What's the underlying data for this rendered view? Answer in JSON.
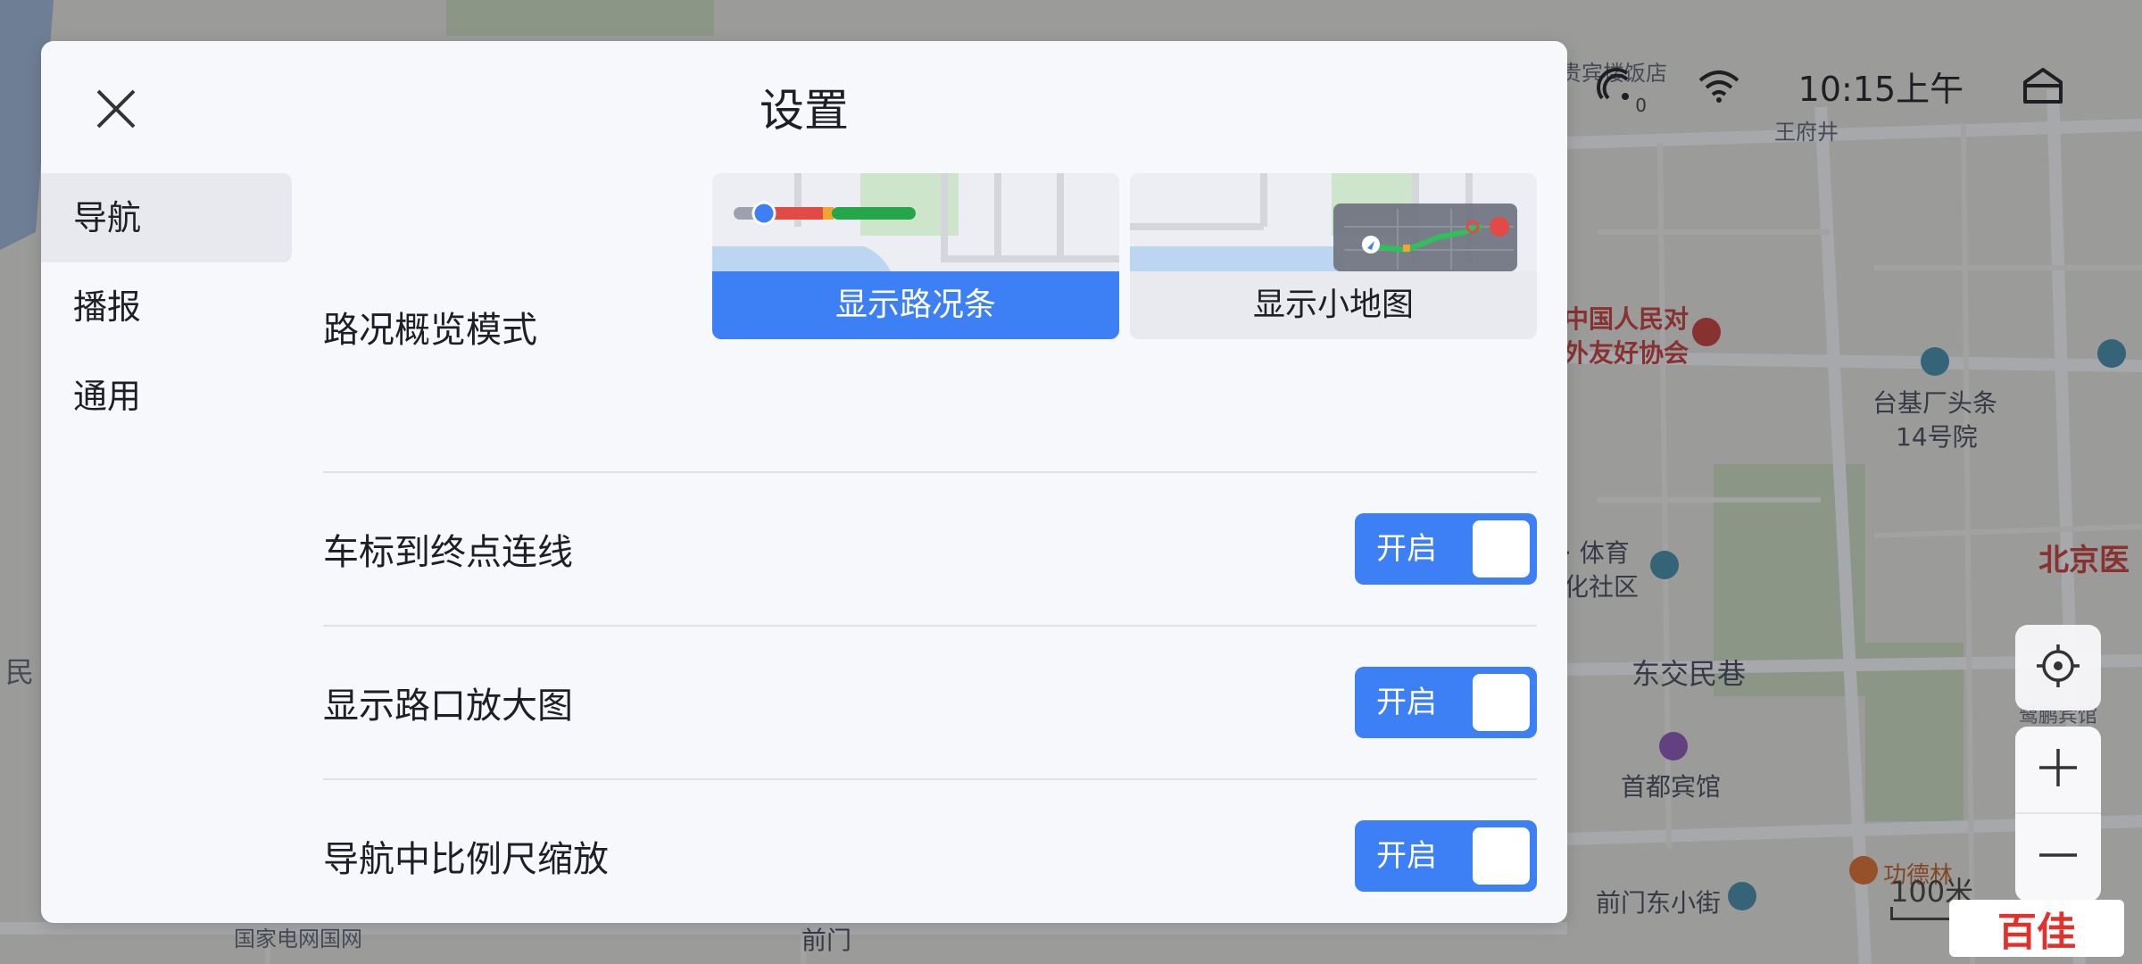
{
  "map": {
    "labels": {
      "hotel_top": "贵宾楼饭店",
      "wangfujing": "王府井",
      "friendship_assoc_1": "中国人民对",
      "friendship_assoc_2": "外友好协会",
      "taiji_1": "台基厂头条",
      "taiji_2": "14号院",
      "sports_1": "· 体育",
      "sports_2": "化社区",
      "dongjiaominxiang": "东交民巷",
      "beijing_partial": "北京医",
      "shoudu_hotel": "首都宾馆",
      "hotel_right": "鹭鹏宾馆",
      "gongdelin": "功德林",
      "qianmen_dong": "前门东小街",
      "state_grid": "国家电网国网",
      "qianmen": "前门",
      "min_left": "民"
    },
    "scale": "100米",
    "watermark": "百佳"
  },
  "status": {
    "time": "10:15上午",
    "signal_badge": "0",
    "icons": [
      "traffic-signal-icon",
      "wifi-icon",
      "home-icon"
    ]
  },
  "map_controls": {
    "icons": [
      "locate-icon",
      "zoom-in-icon",
      "zoom-out-icon"
    ]
  },
  "dialog": {
    "title": "设置",
    "sidebar": [
      {
        "label": "导航",
        "active": true
      },
      {
        "label": "播报",
        "active": false
      },
      {
        "label": "通用",
        "active": false
      }
    ],
    "overview": {
      "label": "路况概览模式",
      "options": [
        {
          "label": "显示路况条",
          "selected": true
        },
        {
          "label": "显示小地图",
          "selected": false
        }
      ]
    },
    "rows": [
      {
        "label": "车标到终点连线",
        "toggle": "开启",
        "on": true
      },
      {
        "label": "显示路口放大图",
        "toggle": "开启",
        "on": true
      },
      {
        "label": "导航中比例尺缩放",
        "toggle": "开启",
        "on": true
      }
    ],
    "accent": "#3d7ff5"
  }
}
